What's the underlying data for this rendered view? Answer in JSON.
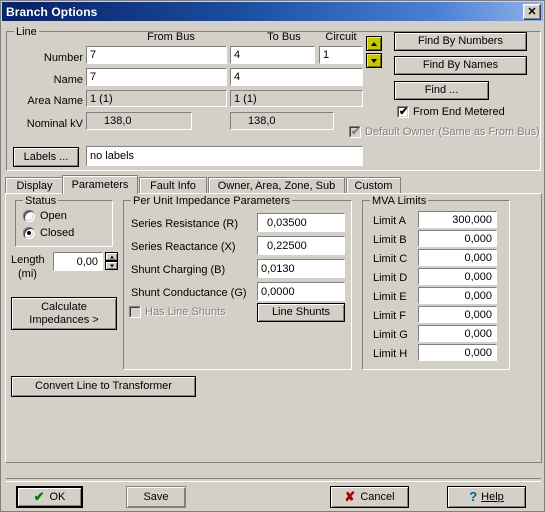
{
  "window": {
    "title": "Branch Options",
    "close_label": "✕"
  },
  "line_group": {
    "title": "Line",
    "columns": {
      "from_bus": "From Bus",
      "to_bus": "To Bus",
      "circuit": "Circuit"
    },
    "rows": [
      {
        "label": "Number",
        "from": "7",
        "to": "4",
        "circuit": "1"
      },
      {
        "label": "Name",
        "from": "7",
        "to": "4"
      },
      {
        "label": "Area Name",
        "from": "1 (1)",
        "to": "1 (1)"
      },
      {
        "label": "Nominal kV",
        "from": "138,0",
        "to": "138,0"
      }
    ],
    "labels_button": "Labels ...",
    "labels_value": "no labels",
    "updown": {
      "up": "▲",
      "down": "▼"
    }
  },
  "find_panel": {
    "find_by_numbers": "Find By Numbers",
    "find_by_names": "Find By Names",
    "find": "Find ...",
    "from_end_metered": {
      "label": "From End Metered",
      "checked": true,
      "mark": "✔"
    },
    "default_owner": {
      "label": "Default Owner (Same as From Bus)",
      "checked": true,
      "mark": "✔"
    }
  },
  "tabs": [
    {
      "label": "Display",
      "active": false
    },
    {
      "label": "Parameters",
      "active": true
    },
    {
      "label": "Fault Info",
      "active": false
    },
    {
      "label": "Owner, Area, Zone, Sub",
      "active": false
    },
    {
      "label": "Custom",
      "active": false
    }
  ],
  "status_group": {
    "title": "Status",
    "options": [
      {
        "label": "Open",
        "selected": false
      },
      {
        "label": "Closed",
        "selected": true
      }
    ]
  },
  "length": {
    "label_line1": "Length",
    "label_line2": "(mi)",
    "value": "0,00"
  },
  "calculate_button": {
    "line1": "Calculate",
    "line2": "Impedances >"
  },
  "impedance_group": {
    "title": "Per Unit Impedance Parameters",
    "fields": [
      {
        "label": "Series Resistance (R)",
        "value": "0,03500"
      },
      {
        "label": "Series Reactance (X)",
        "value": "0,22500"
      },
      {
        "label": "Shunt Charging (B)",
        "value": "0,0130"
      },
      {
        "label": "Shunt Conductance (G)",
        "value": "0,0000"
      }
    ],
    "has_line_shunts": {
      "label": "Has Line Shunts",
      "checked": false
    },
    "line_shunts_button": "Line Shunts"
  },
  "mva_group": {
    "title": "MVA Limits",
    "limits": [
      {
        "label": "Limit A",
        "value": "300,000"
      },
      {
        "label": "Limit B",
        "value": "0,000"
      },
      {
        "label": "Limit C",
        "value": "0,000"
      },
      {
        "label": "Limit D",
        "value": "0,000"
      },
      {
        "label": "Limit E",
        "value": "0,000"
      },
      {
        "label": "Limit F",
        "value": "0,000"
      },
      {
        "label": "Limit G",
        "value": "0,000"
      },
      {
        "label": "Limit H",
        "value": "0,000"
      }
    ]
  },
  "convert_button": "Convert Line to Transformer",
  "footer": {
    "ok": "OK",
    "save": "Save",
    "cancel": "Cancel",
    "help_prefix": "H",
    "help_rest": "elp"
  },
  "colors": {
    "face": "#d4d0c8",
    "title_left": "#0a246a",
    "title_right": "#8fb2e8",
    "ok_check": "#008000",
    "cancel_x": "#aa0000",
    "help_q": "#0060a0",
    "spinner_green": "#c8c800"
  }
}
